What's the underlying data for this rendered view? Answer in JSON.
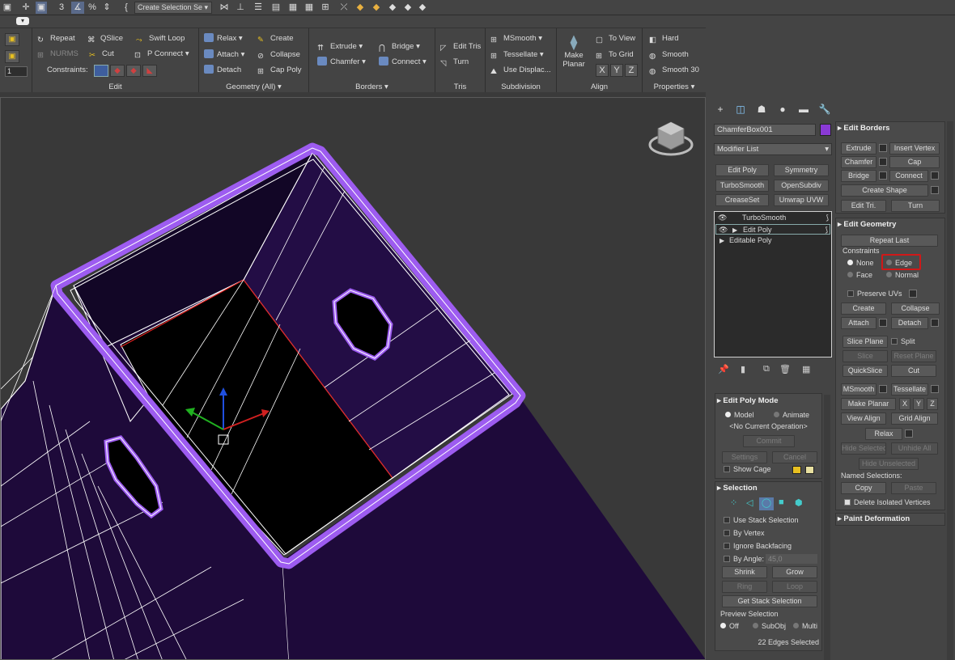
{
  "topbar": {
    "selection_set": "Create Selection Se",
    "icons": [
      "select-object-icon",
      "move-icon",
      "snap-3d-icon",
      "angle-snap-icon",
      "percent-snap-icon",
      "spinner-snap-icon",
      "edit-named-selection-icon",
      "mirror-icon",
      "align-icon",
      "layer-explorer-icon",
      "toggle-ribbon-icon",
      "curve-editor-icon",
      "schematic-view-icon",
      "material-editor-icon",
      "render-setup-icon",
      "render-frame-icon",
      "render-icon"
    ]
  },
  "ribbon": {
    "sections": {
      "edit": {
        "caption": "Edit",
        "repeat": "Repeat",
        "qslice": "QSlice",
        "swift_loop": "Swift Loop",
        "nurms": "NURMS",
        "cut": "Cut",
        "p_connect": "P Connect",
        "constraints": "Constraints:",
        "spinner": "1"
      },
      "geometry": {
        "caption": "Geometry (All)",
        "relax": "Relax",
        "create": "Create",
        "attach": "Attach",
        "collapse": "Collapse",
        "detach": "Detach",
        "cap_poly": "Cap Poly"
      },
      "borders": {
        "caption": "Borders",
        "extrude": "Extrude",
        "bridge": "Bridge",
        "chamfer": "Chamfer",
        "connect": "Connect"
      },
      "tris": {
        "caption": "Tris",
        "edit_tris": "Edit Tris",
        "turn": "Turn"
      },
      "subdivision": {
        "caption": "Subdivision",
        "msmooth": "MSmooth",
        "tessellate": "Tessellate",
        "use_displace": "Use Displac..."
      },
      "align": {
        "caption": "Align",
        "make_planar": "Make Planar",
        "to_view": "To View",
        "to_grid": "To Grid",
        "x": "X",
        "y": "Y",
        "z": "Z"
      },
      "properties": {
        "caption": "Properties",
        "hard": "Hard",
        "smooth": "Smooth",
        "smooth30": "Smooth 30"
      }
    }
  },
  "command_panel": {
    "object_name": "ChamferBox001",
    "object_color": "#8a3ad6",
    "modifier_list": "Modifier List",
    "modifier_buttons": [
      "Edit Poly",
      "Symmetry",
      "TurboSmooth",
      "OpenSubdiv",
      "CreaseSet",
      "Unwrap UVW"
    ],
    "stack": [
      "TurboSmooth",
      "Edit Poly",
      "Editable Poly"
    ]
  },
  "edit_borders": {
    "title": "Edit Borders",
    "extrude": "Extrude",
    "insert_vertex": "Insert Vertex",
    "chamfer": "Chamfer",
    "cap": "Cap",
    "bridge": "Bridge",
    "connect": "Connect",
    "create_shape": "Create Shape",
    "edit_tri": "Edit Tri.",
    "turn": "Turn"
  },
  "edit_geometry": {
    "title": "Edit Geometry",
    "repeat_last": "Repeat Last",
    "constraints_label": "Constraints",
    "none": "None",
    "edge": "Edge",
    "face": "Face",
    "normal": "Normal",
    "preserve_uvs": "Preserve UVs",
    "create": "Create",
    "collapse": "Collapse",
    "attach": "Attach",
    "detach": "Detach",
    "slice_plane": "Slice Plane",
    "split": "Split",
    "slice": "Slice",
    "reset_plane": "Reset Plane",
    "quickslice": "QuickSlice",
    "cut": "Cut",
    "msmooth": "MSmooth",
    "tessellate": "Tessellate",
    "make_planar": "Make Planar",
    "x": "X",
    "y": "Y",
    "z": "Z",
    "view_align": "View Align",
    "grid_align": "Grid Align",
    "relax": "Relax",
    "hide_selected": "Hide Selected",
    "unhide_all": "Unhide All",
    "hide_unselected": "Hide Unselected",
    "named_selections": "Named Selections:",
    "copy": "Copy",
    "paste": "Paste",
    "delete_isolated": "Delete Isolated Vertices"
  },
  "paint_deformation": {
    "title": "Paint Deformation"
  },
  "edit_poly_mode": {
    "title": "Edit Poly Mode",
    "model": "Model",
    "animate": "Animate",
    "status": "<No Current Operation>",
    "commit": "Commit",
    "settings": "Settings",
    "cancel": "Cancel",
    "show_cage": "Show Cage",
    "cage_color1": "#e8c020",
    "cage_color2": "#e8e0a0"
  },
  "selection": {
    "title": "Selection",
    "use_stack": "Use Stack Selection",
    "by_vertex": "By Vertex",
    "ignore_backfacing": "Ignore Backfacing",
    "by_angle": "By Angle:",
    "angle_value": "45,0",
    "shrink": "Shrink",
    "grow": "Grow",
    "ring": "Ring",
    "loop": "Loop",
    "get_stack": "Get Stack Selection",
    "preview_label": "Preview Selection",
    "off": "Off",
    "subobj": "SubObj",
    "multi": "Multi",
    "status": "22 Edges Selected"
  },
  "viewport": {
    "accent": "#9d5cf0",
    "face": "#1e0a3a"
  }
}
